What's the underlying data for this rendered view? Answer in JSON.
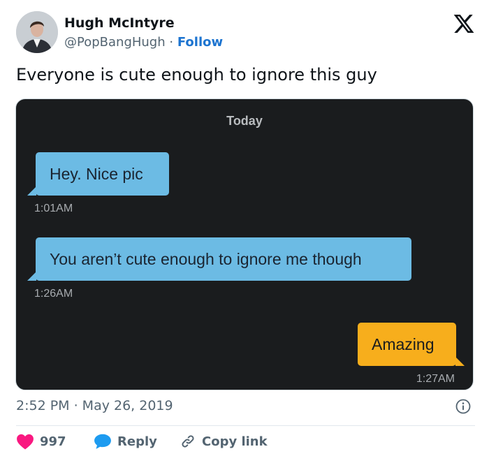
{
  "author": {
    "name": "Hugh McIntyre",
    "handle": "@PopBangHugh",
    "separator": "·",
    "follow_label": "Follow"
  },
  "tweet": {
    "text": "Everyone is cute enough to ignore this guy",
    "timestamp": "2:52 PM · May 26, 2019"
  },
  "chat": {
    "date_header": "Today",
    "messages": [
      {
        "direction": "incoming",
        "text": "Hey. Nice pic",
        "time": "1:01AM"
      },
      {
        "direction": "incoming",
        "text": "You aren’t cute enough to ignore me though",
        "time": "1:26AM"
      },
      {
        "direction": "outgoing",
        "text": "Amazing",
        "time": "1:27AM"
      }
    ]
  },
  "actions": {
    "like_count": "997",
    "reply_label": "Reply",
    "copy_link_label": "Copy link"
  },
  "icons": {
    "brand": "x-logo-icon",
    "info": "info-icon",
    "like": "heart-icon",
    "reply": "speech-bubble-icon",
    "copy": "link-icon"
  },
  "colors": {
    "heart": "#f91880",
    "reply": "#1d9bf0",
    "follow": "#1d74d0",
    "incoming_bubble": "#6cbbe4",
    "outgoing_bubble": "#f7ae1c",
    "chat_background": "#1a1c1e"
  }
}
